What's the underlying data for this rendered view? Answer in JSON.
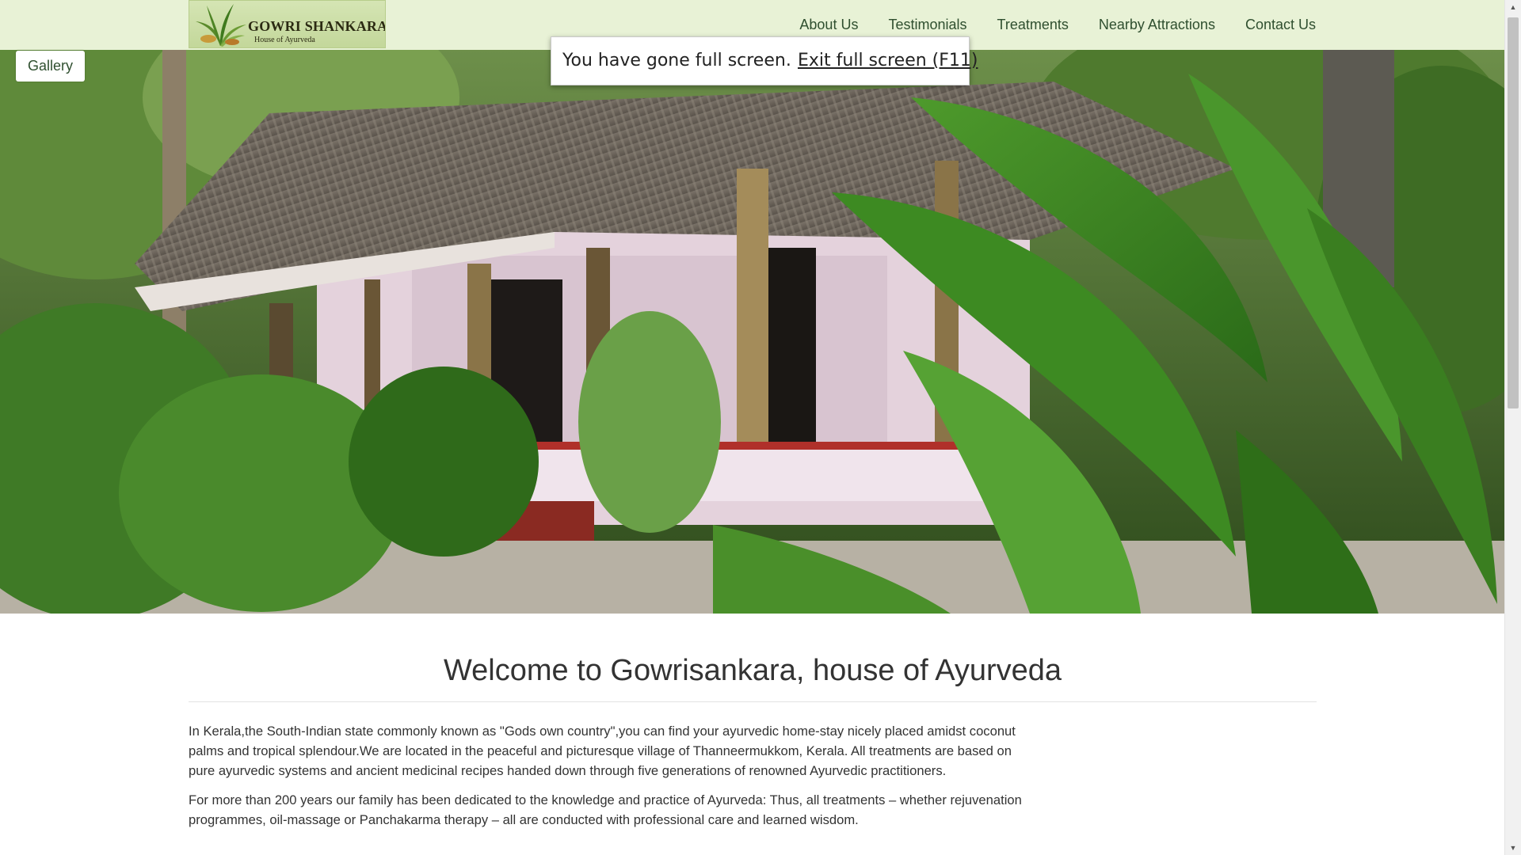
{
  "header": {
    "logo_title": "GOWRI SHANKARA",
    "logo_subtitle": "House of Ayurveda",
    "nav": [
      {
        "label": "About Us"
      },
      {
        "label": "Testimonials"
      },
      {
        "label": "Treatments"
      },
      {
        "label": "Nearby Attractions"
      },
      {
        "label": "Contact Us"
      }
    ]
  },
  "gallery_button": "Gallery",
  "fullscreen_notice": {
    "message": "You have gone full screen.",
    "exit_label": "Exit full screen (F11)"
  },
  "main": {
    "heading": "Welcome to Gowrisankara, house of Ayurveda",
    "paragraphs": [
      "In Kerala,the South-Indian state commonly known as \"Gods own country\",you can find your ayurvedic home-stay nicely placed amidst coconut palms and tropical splendour.We are located in the peaceful and picturesque village of Thanneermukkom, Kerala. All treatments are based on pure ayurvedic systems and ancient medicinal recipes handed down through five generations of renowned Ayurvedic practitioners.",
      "For more than 200 years our family has been dedicated to the knowledge and practice of Ayurveda: Thus, all treatments – whether rejuvenation programmes, oil-massage or Panchakarma therapy – all are conducted with professional care and learned wisdom."
    ]
  },
  "colors": {
    "navbar_bg": "#e8f2d6",
    "nav_text": "#2f4f2f",
    "body_text": "#333333"
  },
  "icons": {
    "scroll_up": "scroll-up-arrow-icon",
    "scroll_down": "scroll-down-arrow-icon"
  }
}
